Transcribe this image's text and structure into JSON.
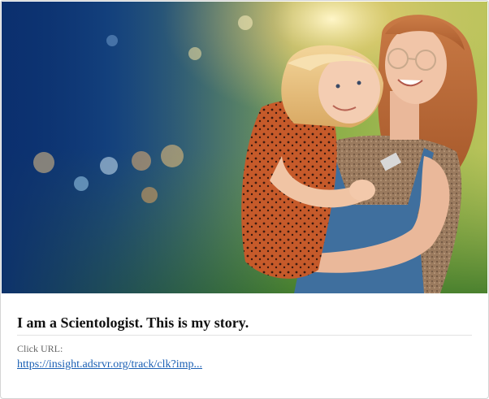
{
  "ad": {
    "headline": "I am a Scientologist. This is my story.",
    "click_url_label": "Click URL:",
    "click_url": "https://insight.adsrvr.org/track/clk?imp...",
    "image_icon": "photo-mother-and-daughter"
  },
  "colors": {
    "link": "#1a5fb4",
    "headline": "#111111",
    "label": "#666666",
    "divider": "#e2e2e2",
    "card_border": "#d4d4d4"
  }
}
